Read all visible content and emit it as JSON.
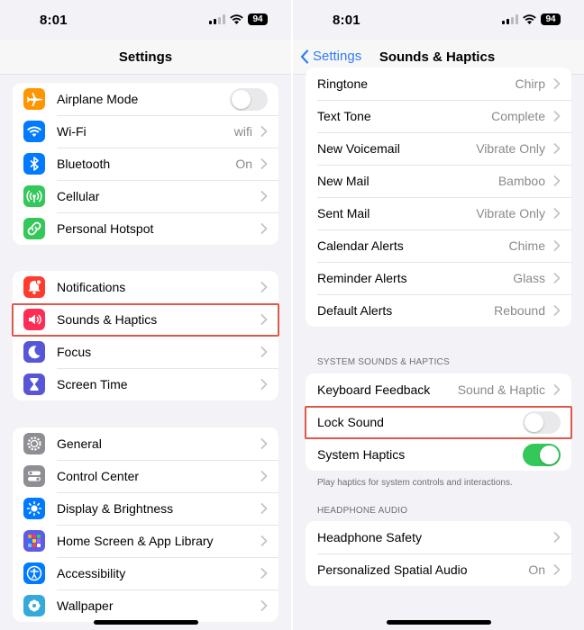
{
  "left": {
    "status": {
      "time": "8:01",
      "battery": "94"
    },
    "nav": {
      "title": "Settings"
    },
    "groups": [
      [
        {
          "label": "Airplane Mode",
          "value": "",
          "control": "toggle-off",
          "icon": "airplane-icon",
          "color": "#ff9500"
        },
        {
          "label": "Wi-Fi",
          "value": "wifi",
          "control": "chevron",
          "icon": "wifi-icon",
          "color": "#007aff"
        },
        {
          "label": "Bluetooth",
          "value": "On",
          "control": "chevron",
          "icon": "bluetooth-icon",
          "color": "#007aff"
        },
        {
          "label": "Cellular",
          "value": "",
          "control": "chevron",
          "icon": "cellular-icon",
          "color": "#34c759"
        },
        {
          "label": "Personal Hotspot",
          "value": "",
          "control": "chevron",
          "icon": "hotspot-icon",
          "color": "#34c759"
        }
      ],
      [
        {
          "label": "Notifications",
          "value": "",
          "control": "chevron",
          "icon": "bell-icon",
          "color": "#ff3b30"
        },
        {
          "label": "Sounds & Haptics",
          "value": "",
          "control": "chevron",
          "icon": "speaker-icon",
          "color": "#ff2d55"
        },
        {
          "label": "Focus",
          "value": "",
          "control": "chevron",
          "icon": "moon-icon",
          "color": "#5856d6"
        },
        {
          "label": "Screen Time",
          "value": "",
          "control": "chevron",
          "icon": "hourglass-icon",
          "color": "#5856d6"
        }
      ],
      [
        {
          "label": "General",
          "value": "",
          "control": "chevron",
          "icon": "gear-icon",
          "color": "#8e8e93"
        },
        {
          "label": "Control Center",
          "value": "",
          "control": "chevron",
          "icon": "switches-icon",
          "color": "#8e8e93"
        },
        {
          "label": "Display & Brightness",
          "value": "",
          "control": "chevron",
          "icon": "sun-icon",
          "color": "#007aff"
        },
        {
          "label": "Home Screen & App Library",
          "value": "",
          "control": "chevron",
          "icon": "grid-icon",
          "color": "#5e5ce6"
        },
        {
          "label": "Accessibility",
          "value": "",
          "control": "chevron",
          "icon": "accessibility-icon",
          "color": "#007aff"
        },
        {
          "label": "Wallpaper",
          "value": "",
          "control": "chevron",
          "icon": "flower-icon",
          "color": "#34aadc"
        }
      ]
    ]
  },
  "right": {
    "status": {
      "time": "8:01",
      "battery": "94"
    },
    "nav": {
      "title": "Sounds & Haptics",
      "back_label": "Settings"
    },
    "tones": [
      {
        "label": "Ringtone",
        "value": "Chirp",
        "control": "chevron"
      },
      {
        "label": "Text Tone",
        "value": "Complete",
        "control": "chevron"
      },
      {
        "label": "New Voicemail",
        "value": "Vibrate Only",
        "control": "chevron"
      },
      {
        "label": "New Mail",
        "value": "Bamboo",
        "control": "chevron"
      },
      {
        "label": "Sent Mail",
        "value": "Vibrate Only",
        "control": "chevron"
      },
      {
        "label": "Calendar Alerts",
        "value": "Chime",
        "control": "chevron"
      },
      {
        "label": "Reminder Alerts",
        "value": "Glass",
        "control": "chevron"
      },
      {
        "label": "Default Alerts",
        "value": "Rebound",
        "control": "chevron"
      }
    ],
    "system_header": "SYSTEM SOUNDS & HAPTICS",
    "system": [
      {
        "label": "Keyboard Feedback",
        "value": "Sound & Haptic",
        "control": "chevron"
      },
      {
        "label": "Lock Sound",
        "value": "",
        "control": "toggle-off"
      },
      {
        "label": "System Haptics",
        "value": "",
        "control": "toggle-on"
      }
    ],
    "system_footer": "Play haptics for system controls and interactions.",
    "headphone_header": "HEADPHONE AUDIO",
    "headphone": [
      {
        "label": "Headphone Safety",
        "value": "",
        "control": "chevron"
      },
      {
        "label": "Personalized Spatial Audio",
        "value": "On",
        "control": "chevron"
      }
    ]
  },
  "colors": {
    "highlight": "#e0574c",
    "accent": "#2f7cf6",
    "toggle_on": "#34c759"
  }
}
